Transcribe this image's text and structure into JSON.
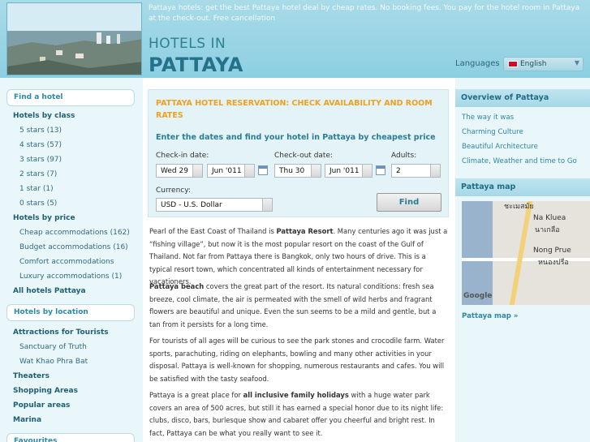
{
  "header": {
    "tagline": "Pattaya hotels: get the best Pattaya hotel deal by cheap rates. No booking fees. You pay for the hotel room in Pattaya at the check-out. Free cancellation",
    "title_line1": "HOTELS IN",
    "title_line2": "PATTAYA",
    "languages_label": "Languages",
    "language_selected": "English"
  },
  "sidebar": {
    "find_hotel": "Find a hotel",
    "by_class": "Hotels by class",
    "classes": [
      "5 stars (13)",
      "4 stars (57)",
      "3 stars (97)",
      "2 stars (7)",
      "1 star (1)",
      "0 stars (5)"
    ],
    "by_price": "Hotels by price",
    "prices": [
      "Cheap accommodations (162)",
      "Budget accommodations (16)",
      "Comfort accommodations",
      "Luxury accommodations (1)"
    ],
    "all_hotels": "All hotels Pattaya",
    "by_location": "Hotels by location",
    "attractions": "Attractions for Tourists",
    "attraction_items": [
      "Sanctuary of Truth",
      "Wat Khao Phra Bat"
    ],
    "theaters": "Theaters",
    "shopping": "Shopping Areas",
    "popular": "Popular areas",
    "marina": "Marina",
    "favourites": "Favourites"
  },
  "form": {
    "title": "PATTAYA HOTEL RESERVATION: CHECK AVAILABILITY AND ROOM RATES",
    "subtitle": "Enter the dates and find your hotel in Pattaya by cheapest price",
    "checkin_label": "Check-in date:",
    "checkin_day": "Wed 29",
    "checkin_month": "Jun '011",
    "checkout_label": "Check-out date:",
    "checkout_day": "Thu 30",
    "checkout_month": "Jun '011",
    "adults_label": "Adults:",
    "adults_value": "2",
    "currency_label": "Currency:",
    "currency_value": "USD - U.S. Dollar",
    "find_button": "Find"
  },
  "content": {
    "p1_a": "Pearl of the East Coast of Thailand is ",
    "p1_b": "Pattaya Resort",
    "p1_c": ". Many centuries ago it was just a “fishing village”, but now it is the most popular resort on the coast of the Gulf of Thailand. Not far from Pattaya there is Bangkok, only two hours of drive. This is a typical resort town, which concentrated all kinds of entertainment necessary for vacationers.",
    "p2_a": "Pattaya beach",
    "p2_b": " covers the great part of the resort. Its natural conditions: fresh sea breeze, cool climate, the air is permeated with the smell of wild herbs and fragrant flowers are beautiful and unique. Even the sun seems to be a mild and gentle, but a tan from it persists for a long time.",
    "p3": "For tourists of all ages will be curious to see the park stones and crocodile farm. Water sports, parachuting, riding on elephants, bowling and many other activities in your disposal. Pattaya is well-known for shopping, numerous restaurants and cafes. You will be satisfied with the tasty seafood.",
    "p4_a": "Pattaya is a great place for ",
    "p4_b": "all inclusive family holidays",
    "p4_c": " with a huge water park covers an area of 500 acres, but still it has earned a special honor due to its night life: clubs, disco, bars, burlesque show and cabaret offer you cheerful and bright rest. In fact, Pattaya can be what you really want to see it."
  },
  "right": {
    "overview_title": "Overview of Pattaya",
    "links": [
      "The way it was",
      "Charming Culture",
      "Beautiful Architecture",
      "Climate, Weather and time to Go"
    ],
    "map_title": "Pattaya map",
    "map_labels": {
      "top": "ชะเมสมัย",
      "na_kluea": "Na Kluea",
      "na_kluea_th": "นาเกลือ",
      "nong_prue": "Nong Prue",
      "nong_prue_th": "หนองปรือ",
      "google": "Google"
    },
    "map_link": "Pattaya map »"
  },
  "colors": {
    "accent": "#2a8aa7",
    "form_title": "#f0a020",
    "header_bg": "#a9dbe8"
  }
}
